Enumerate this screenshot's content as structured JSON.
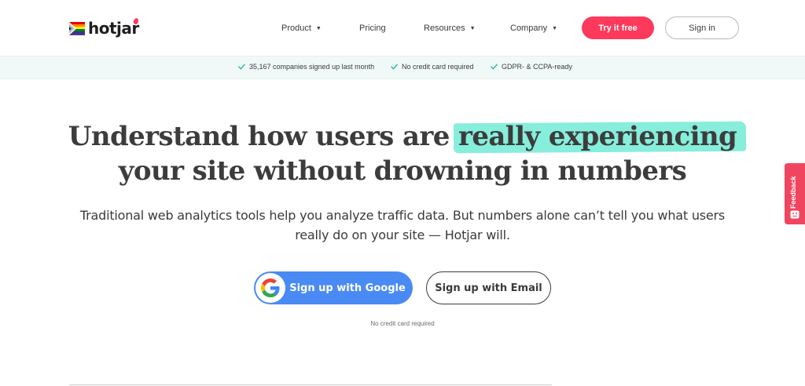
{
  "header": {
    "logo_text": "hotjar",
    "nav": [
      {
        "label": "Product",
        "has_dropdown": true
      },
      {
        "label": "Pricing",
        "has_dropdown": false
      },
      {
        "label": "Resources",
        "has_dropdown": true
      },
      {
        "label": "Company",
        "has_dropdown": true
      }
    ],
    "try_label": "Try it free",
    "signin_label": "Sign in"
  },
  "trust_bar": {
    "items": [
      "35,167 companies signed up last month",
      "No credit card required",
      "GDPR- & CCPA-ready"
    ],
    "check_icon": "check-icon"
  },
  "hero": {
    "headline_part1": "Understand how users are",
    "headline_highlight": "really experiencing",
    "headline_part2": "your site without drowning in numbers",
    "subhead": "Traditional web analytics tools help you analyze traffic data. But numbers alone can’t tell you what users really do on your site — Hotjar will.",
    "google_button_label": "Sign up with Google",
    "email_button_label": "Sign up with Email",
    "fine_print": "No credit card required"
  },
  "feedback_tab": {
    "label": "Feedback"
  },
  "colors": {
    "brand_red": "#fd3a5c",
    "google_blue": "#4a8af4",
    "highlight_teal": "#5ee8cf",
    "check_teal": "#2bb8a4",
    "trust_bg": "#f0f9f8"
  }
}
